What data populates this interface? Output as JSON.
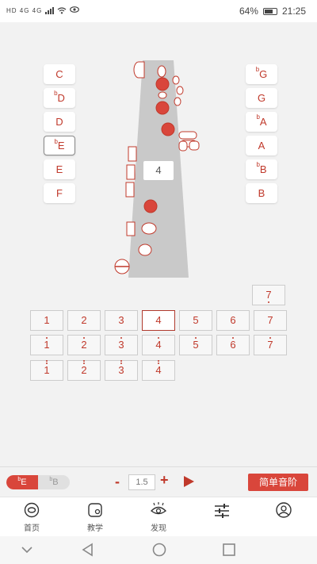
{
  "status_bar": {
    "left_text": "HD 4G 4G",
    "battery": "64%",
    "time": "21:25"
  },
  "left_keys": [
    {
      "flat": "",
      "label": "C"
    },
    {
      "flat": "b",
      "label": "D"
    },
    {
      "flat": "",
      "label": "D"
    },
    {
      "flat": "b",
      "label": "E"
    },
    {
      "flat": "",
      "label": "E"
    },
    {
      "flat": "",
      "label": "F"
    }
  ],
  "right_keys": [
    {
      "flat": "b",
      "label": "G"
    },
    {
      "flat": "",
      "label": "G"
    },
    {
      "flat": "b",
      "label": "A"
    },
    {
      "flat": "",
      "label": "A"
    },
    {
      "flat": "b",
      "label": "B"
    },
    {
      "flat": "",
      "label": "B"
    }
  ],
  "selected_key_index": 3,
  "fingering": {
    "degree": "4"
  },
  "notes": {
    "top_extra": "7",
    "row_middle": [
      "1",
      "2",
      "3",
      "4",
      "5",
      "6",
      "7"
    ],
    "row_high": [
      "1",
      "2",
      "3",
      "4",
      "5",
      "6",
      "7"
    ],
    "row_highest": [
      "1",
      "2",
      "3",
      "4"
    ],
    "active_index": 3
  },
  "controls": {
    "toggle_on": {
      "flat": "b",
      "label": "E"
    },
    "toggle_off": {
      "flat": "b",
      "label": "B"
    },
    "minus": "-",
    "speed": "1.5",
    "plus": "+",
    "scale_button": "简单音阶"
  },
  "bottom_nav": [
    {
      "label": "首页",
      "icon": "home-icon"
    },
    {
      "label": "教学",
      "icon": "teaching-icon"
    },
    {
      "label": "发现",
      "icon": "eye-icon"
    },
    {
      "label": "",
      "icon": "sliders-icon"
    },
    {
      "label": "",
      "icon": "user-icon"
    }
  ],
  "colors": {
    "accent": "#d9463b",
    "text_red": "#c0392b"
  }
}
